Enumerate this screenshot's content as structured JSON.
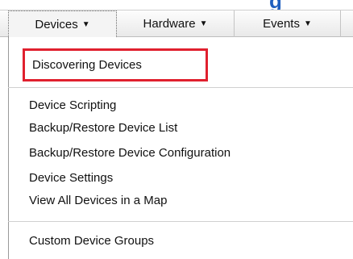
{
  "header": {
    "partial_title": "g"
  },
  "menubar": {
    "menus": [
      {
        "label": "Devices",
        "caret": "▼"
      },
      {
        "label": "Hardware",
        "caret": "▼"
      },
      {
        "label": "Events",
        "caret": "▼"
      }
    ]
  },
  "devices_menu": {
    "highlighted_item": "Discovering Devices",
    "items": [
      "Device Scripting",
      "Backup/Restore Device List",
      "Backup/Restore Device Configuration",
      "Device Settings",
      "View All Devices in a Map"
    ],
    "group_items": [
      "Custom Device Groups"
    ]
  },
  "colors": {
    "highlight_border": "#e0202e",
    "heading_blue": "#1f5fbf"
  }
}
